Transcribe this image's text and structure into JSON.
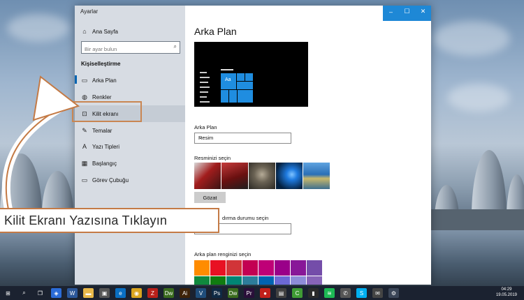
{
  "window": {
    "title": "Ayarlar",
    "controls": [
      "–",
      "☐",
      "✕"
    ]
  },
  "sidebar": {
    "home_label": "Ana Sayfa",
    "search_placeholder": "Bir ayar bulun",
    "section_title": "Kişiselleştirme",
    "items": [
      {
        "label": "Arka Plan",
        "icon": "picture-icon"
      },
      {
        "label": "Renkler",
        "icon": "palette-icon"
      },
      {
        "label": "Kilit ekranı",
        "icon": "lock-screen-icon"
      },
      {
        "label": "Temalar",
        "icon": "brush-icon"
      },
      {
        "label": "Yazı Tipleri",
        "icon": "font-icon"
      },
      {
        "label": "Başlangıç",
        "icon": "start-icon"
      },
      {
        "label": "Görev Çubuğu",
        "icon": "taskbar-icon"
      }
    ]
  },
  "content": {
    "page_title": "Arka Plan",
    "preview_tile_text": "Aa",
    "background_label": "Arka Plan",
    "background_value": "Resim",
    "choose_picture_label": "Resminizi seçin",
    "thumbs": [
      {
        "name": "turkish-flag-thumbnail",
        "colors": [
          "#8c1c1c",
          "#e8e8e8"
        ]
      },
      {
        "name": "ataturk-flag-thumbnail",
        "colors": [
          "#5a0e0e",
          "#c63b3b"
        ]
      },
      {
        "name": "wolf-thumbnail",
        "colors": [
          "#3e3a33",
          "#9c9484"
        ]
      },
      {
        "name": "windows-blue-thumbnail",
        "colors": [
          "#05203e",
          "#1f7be0"
        ]
      },
      {
        "name": "lake-landscape-thumbnail",
        "colors": [
          "#2a6fb6",
          "#c9b86b"
        ]
      }
    ],
    "browse_label": "Gözat",
    "fit_label_partial": "dırma durumu seçin",
    "accent_label": "Arka plan renginizi seçin",
    "swatch_colors": [
      "#ff8c00",
      "#e81123",
      "#d13438",
      "#c30052",
      "#bf0077",
      "#9a0089",
      "#881798",
      "#744da9",
      "#10893e",
      "#107c10",
      "#018574",
      "#2d7d9a",
      "#0063b1",
      "#6b69d6",
      "#8e8cd8",
      "#8764b8"
    ]
  },
  "overlay": {
    "banner_text": "Kilit Ekranı Yazısına Tıklayın",
    "accent_color": "#c47a45"
  },
  "taskbar": {
    "icons": [
      {
        "name": "start-icon",
        "glyph": "⊞",
        "color": "transparent"
      },
      {
        "name": "search-icon",
        "glyph": "⌕",
        "color": "transparent"
      },
      {
        "name": "task-view-icon",
        "glyph": "❐",
        "color": "transparent"
      },
      {
        "name": "shield-app-icon",
        "glyph": "◈",
        "color": "#2b6cd8"
      },
      {
        "name": "word-app-icon",
        "glyph": "W",
        "color": "#2b579a"
      },
      {
        "name": "folder-app-icon",
        "glyph": "▬",
        "color": "#e8b84a"
      },
      {
        "name": "store-app-icon",
        "glyph": "▣",
        "color": "#555"
      },
      {
        "name": "edge-app-icon",
        "glyph": "e",
        "color": "#0a6fc2"
      },
      {
        "name": "chrome-app-icon",
        "glyph": "◉",
        "color": "#d9a520"
      },
      {
        "name": "filezilla-app-icon",
        "glyph": "Z",
        "color": "#b8201a"
      },
      {
        "name": "dreamweaver-app-icon",
        "glyph": "Dw",
        "color": "#3a6b1e"
      },
      {
        "name": "illustrator-app-icon",
        "glyph": "Ai",
        "color": "#3d2208"
      },
      {
        "name": "v-app-icon",
        "glyph": "V",
        "color": "#1f4d7a"
      },
      {
        "name": "photoshop-app-icon",
        "glyph": "Ps",
        "color": "#0f2a44"
      },
      {
        "name": "dreamweaver-2-app-icon",
        "glyph": "Dw",
        "color": "#3a6b1e"
      },
      {
        "name": "premiere-app-icon",
        "glyph": "Pr",
        "color": "#2a0f3a"
      },
      {
        "name": "record-app-icon",
        "glyph": "●",
        "color": "#c0201a"
      },
      {
        "name": "gallery-app-icon",
        "glyph": "▤",
        "color": "#404040"
      },
      {
        "name": "camtasia-app-icon",
        "glyph": "C",
        "color": "#3f9b35"
      },
      {
        "name": "terminal-app-icon",
        "glyph": "▮",
        "color": "#2b2b2b"
      },
      {
        "name": "spotify-app-icon",
        "glyph": "≋",
        "color": "#1db954"
      },
      {
        "name": "phone-app-icon",
        "glyph": "✆",
        "color": "#555"
      },
      {
        "name": "skype-app-icon",
        "glyph": "S",
        "color": "#00aff0"
      },
      {
        "name": "mail-app-icon",
        "glyph": "✉",
        "color": "#444"
      },
      {
        "name": "settings-app-icon",
        "glyph": "⚙",
        "color": "#3a4557"
      }
    ],
    "time": "04:29",
    "date": "19.05.2019"
  }
}
